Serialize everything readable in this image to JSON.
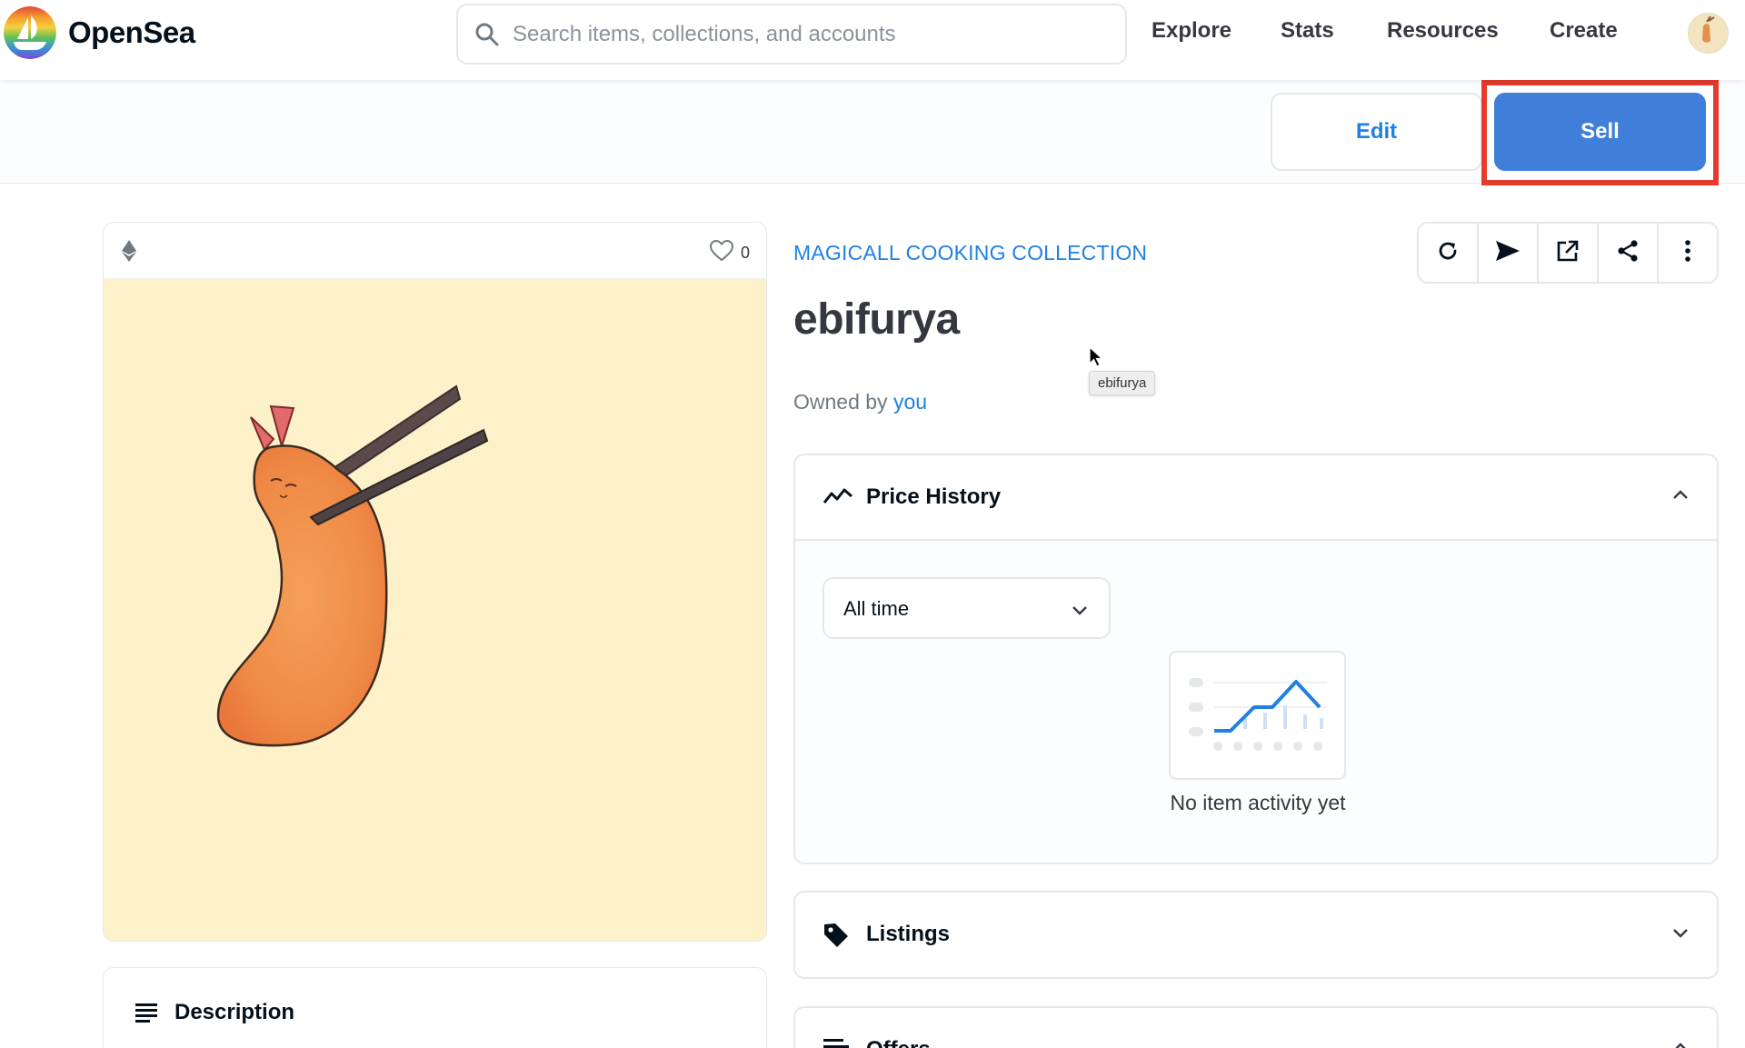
{
  "nav": {
    "brand": "OpenSea",
    "search_placeholder": "Search items, collections, and accounts",
    "links": [
      "Explore",
      "Stats",
      "Resources",
      "Create"
    ]
  },
  "actions": {
    "edit_label": "Edit",
    "sell_label": "Sell"
  },
  "asset": {
    "favorites_count": "0",
    "collection": "MAGICALL COOKING COLLECTION",
    "title": "ebifurya",
    "tooltip": "ebifurya",
    "owned_prefix": "Owned by",
    "owner": "you"
  },
  "toolbar": {
    "icons": [
      "refresh-icon",
      "transfer-icon",
      "external-link-icon",
      "share-icon",
      "more-icon"
    ]
  },
  "price_history": {
    "title": "Price History",
    "range": "All time",
    "empty": "No item activity yet"
  },
  "listings": {
    "title": "Listings"
  },
  "offers": {
    "title": "Offers"
  },
  "description": {
    "title": "Description"
  },
  "colors": {
    "accent": "#2081e2",
    "sell_button": "#3f7fd9",
    "highlight": "#e53b2c",
    "artwork_bg": "#fdf1c9"
  }
}
